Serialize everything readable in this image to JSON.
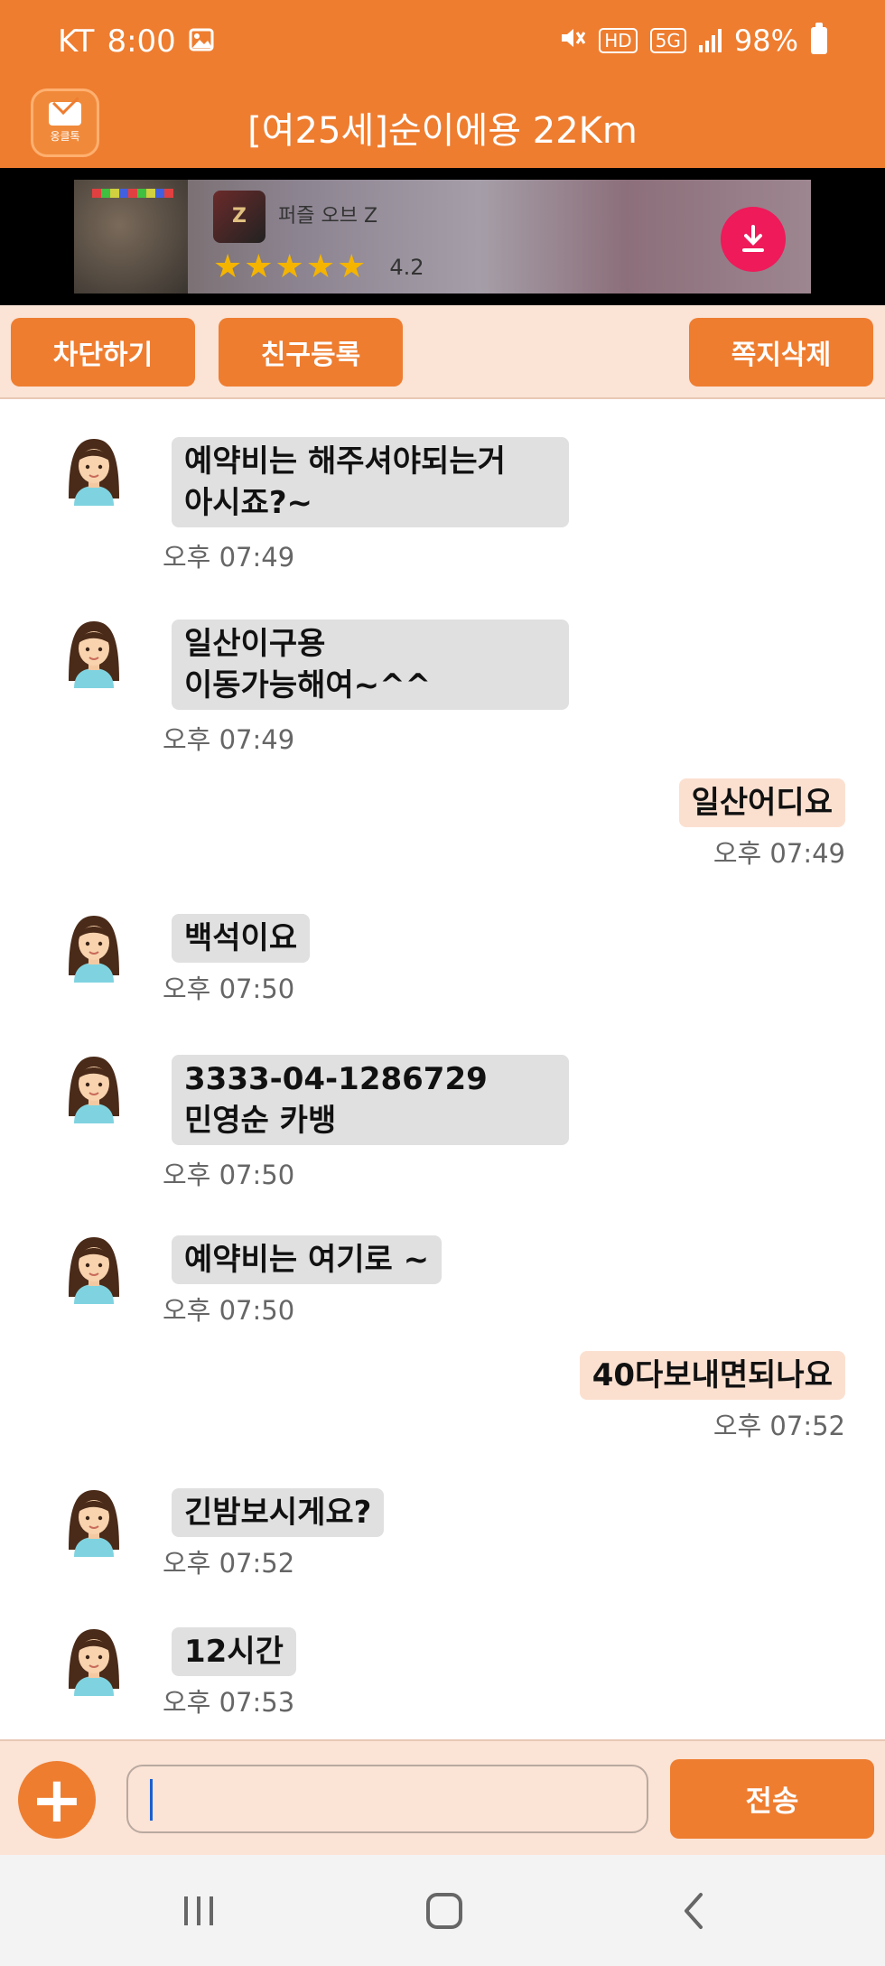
{
  "status_bar": {
    "carrier": "KT",
    "time": "8:00",
    "hd": "HD",
    "network": "5G",
    "battery": "98%"
  },
  "app": {
    "logo_label": "옹클톡",
    "title": "[여25세]순이에용 22Km"
  },
  "ad": {
    "app_name": "퍼즐 오브 Z",
    "stars": "★★★★★",
    "rating": "4.2"
  },
  "actions": {
    "block": "차단하기",
    "add_friend": "친구등록",
    "delete_messages": "쪽지삭제"
  },
  "messages": [
    {
      "side": "in",
      "text": "예약비는 해주셔야되는거\n아시죠?~",
      "time": "오후 07:49"
    },
    {
      "side": "in",
      "text": "일산이구용\n이동가능해여~^^",
      "time": "오후 07:49"
    },
    {
      "side": "out",
      "text": "일산어디요",
      "time": "오후 07:49"
    },
    {
      "side": "in",
      "text": "백석이요",
      "time": "오후 07:50"
    },
    {
      "side": "in",
      "text": "3333-04-1286729\n민영순 카뱅",
      "time": "오후 07:50"
    },
    {
      "side": "in",
      "text": "예약비는 여기로 ~",
      "time": "오후 07:50"
    },
    {
      "side": "out",
      "text": "40다보내면되나요",
      "time": "오후 07:52"
    },
    {
      "side": "in",
      "text": "긴밤보시게요?",
      "time": "오후 07:52"
    },
    {
      "side": "in",
      "text": "12시간",
      "time": "오후 07:53"
    }
  ],
  "composer": {
    "plus": "+",
    "value": "",
    "send": "전송"
  },
  "colors": {
    "accent": "#ee7d30",
    "panel": "#fbe3d5",
    "incoming_bubble": "#e0e0e0",
    "outgoing_bubble": "#fbe0d0"
  }
}
